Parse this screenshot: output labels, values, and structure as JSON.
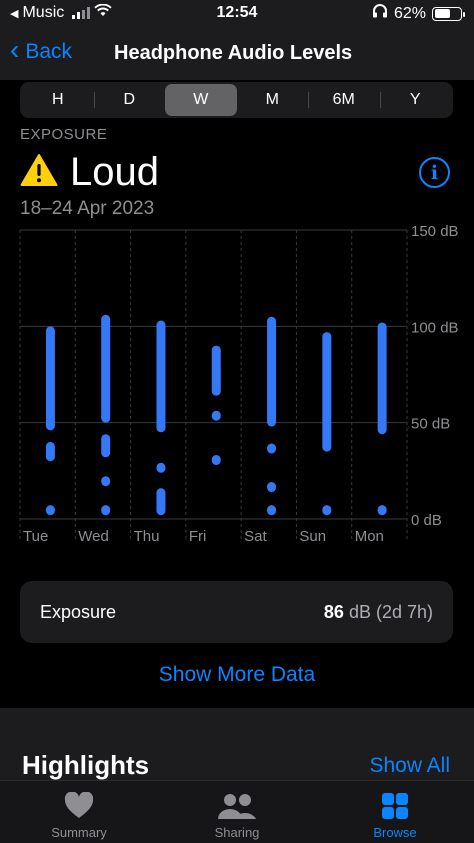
{
  "status": {
    "back_app": "Music",
    "time": "12:54",
    "battery": "62%",
    "battery_level": 0.62
  },
  "nav": {
    "back_label": "Back",
    "title": "Headphone Audio Levels"
  },
  "segments": [
    "H",
    "D",
    "W",
    "M",
    "6M",
    "Y"
  ],
  "active_segment": "W",
  "summary": {
    "section_label": "EXPOSURE",
    "headline": "Loud",
    "date_range": "18–24 Apr 2023"
  },
  "chart_data": {
    "type": "range",
    "categories": [
      "Tue",
      "Wed",
      "Thu",
      "Fri",
      "Sat",
      "Sun",
      "Mon"
    ],
    "y_ticks": [
      "150 dB",
      "100 dB",
      "50 dB",
      "0 dB"
    ],
    "ylim": [
      0,
      150
    ],
    "series": [
      {
        "category": "Tue",
        "ranges": [
          [
            2,
            3
          ],
          [
            30,
            40
          ],
          [
            46,
            100
          ]
        ]
      },
      {
        "category": "Wed",
        "ranges": [
          [
            2,
            3
          ],
          [
            17,
            20
          ],
          [
            32,
            44
          ],
          [
            50,
            106
          ]
        ]
      },
      {
        "category": "Thu",
        "ranges": [
          [
            2,
            16
          ],
          [
            24,
            28
          ],
          [
            45,
            103
          ]
        ]
      },
      {
        "category": "Fri",
        "ranges": [
          [
            28,
            30
          ],
          [
            51,
            56
          ],
          [
            64,
            90
          ]
        ]
      },
      {
        "category": "Sat",
        "ranges": [
          [
            2,
            3
          ],
          [
            14,
            18
          ],
          [
            34,
            39
          ],
          [
            48,
            105
          ]
        ]
      },
      {
        "category": "Sun",
        "ranges": [
          [
            2,
            3
          ],
          [
            35,
            97
          ]
        ]
      },
      {
        "category": "Mon",
        "ranges": [
          [
            2,
            3
          ],
          [
            44,
            102
          ]
        ]
      }
    ],
    "bar_color": "#3478f6",
    "grid_color": "#3a3a3c"
  },
  "exposure_card": {
    "label": "Exposure",
    "value": "86",
    "unit": " dB (2d 7h)"
  },
  "show_more": "Show More Data",
  "highlights": {
    "title": "Highlights",
    "show_all": "Show All"
  },
  "tabs": [
    {
      "label": "Summary",
      "icon": "heart-icon"
    },
    {
      "label": "Sharing",
      "icon": "people-icon"
    },
    {
      "label": "Browse",
      "icon": "grid-icon"
    }
  ],
  "active_tab": "Browse",
  "colors": {
    "accent": "#0a84ff",
    "warning": "#fdd00a"
  }
}
